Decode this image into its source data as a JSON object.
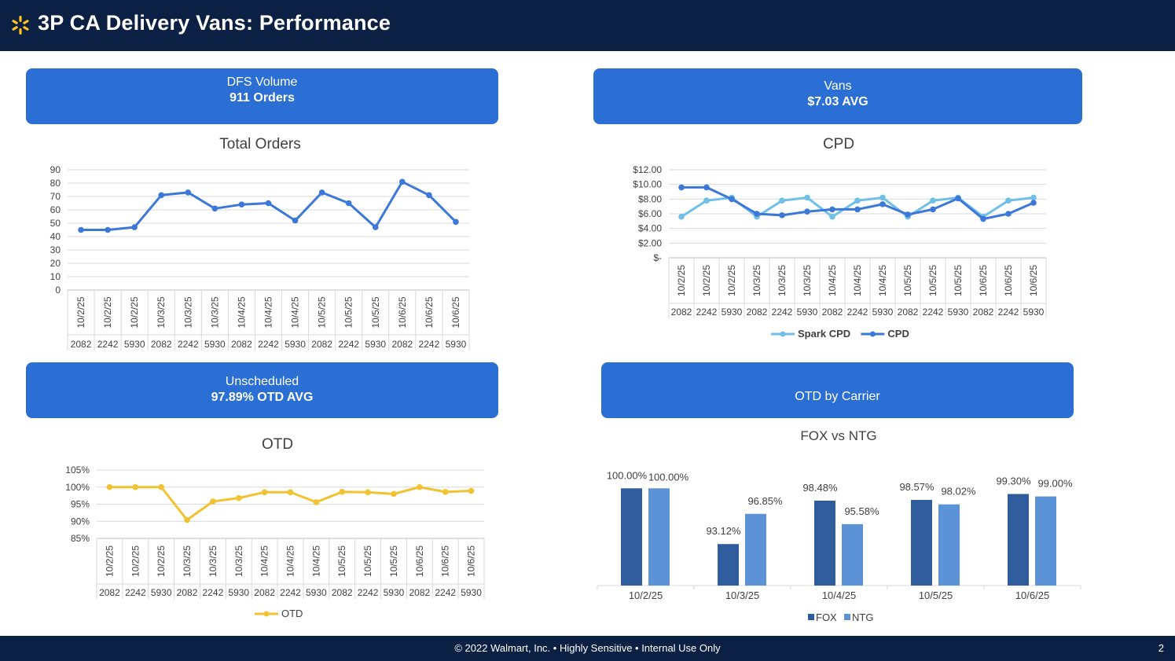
{
  "header": {
    "title": "3P CA Delivery Vans: Performance",
    "logo_icon": "walmart-spark-icon",
    "accent": "#ffc220",
    "background": "#0b2042"
  },
  "banners": {
    "dfs": {
      "line1": "DFS Volume",
      "line2": "911 Orders"
    },
    "vans": {
      "line1": "Vans",
      "line2": "$7.03 AVG"
    },
    "unscheduled": {
      "line1": "Unscheduled",
      "line2": "97.89% OTD AVG"
    },
    "carrier": {
      "line1": "OTD by Carrier",
      "line2": ""
    },
    "color": "#2b6fd4"
  },
  "chart_data": [
    {
      "id": "total_orders",
      "type": "line",
      "title": "Total Orders",
      "categories_date": [
        "10/2/25",
        "10/2/25",
        "10/2/25",
        "10/3/25",
        "10/3/25",
        "10/3/25",
        "10/4/25",
        "10/4/25",
        "10/4/25",
        "10/5/25",
        "10/5/25",
        "10/5/25",
        "10/6/25",
        "10/6/25",
        "10/6/25"
      ],
      "categories_store": [
        "2082",
        "2242",
        "5930",
        "2082",
        "2242",
        "5930",
        "2082",
        "2242",
        "5930",
        "2082",
        "2242",
        "5930",
        "2082",
        "2242",
        "5930"
      ],
      "series": [
        {
          "values": [
            45,
            45,
            47,
            71,
            73,
            61,
            64,
            65,
            52,
            73,
            65,
            47,
            81,
            71,
            51
          ],
          "color": "#3c78d8"
        }
      ],
      "ylim": [
        0,
        90
      ],
      "yticks": [
        "0",
        "10",
        "20",
        "30",
        "40",
        "50",
        "60",
        "70",
        "80",
        "90"
      ],
      "grid": true
    },
    {
      "id": "cpd",
      "type": "line",
      "title": "CPD",
      "categories_date": [
        "10/2/25",
        "10/2/25",
        "10/2/25",
        "10/3/25",
        "10/3/25",
        "10/3/25",
        "10/4/25",
        "10/4/25",
        "10/4/25",
        "10/5/25",
        "10/5/25",
        "10/5/25",
        "10/6/25",
        "10/6/25",
        "10/6/25"
      ],
      "categories_store": [
        "2082",
        "2242",
        "5930",
        "2082",
        "2242",
        "5930",
        "2082",
        "2242",
        "5930",
        "2082",
        "2242",
        "5930",
        "2082",
        "2242",
        "5930"
      ],
      "series": [
        {
          "name": "Spark CPD",
          "values": [
            5.6,
            7.8,
            8.2,
            5.6,
            7.8,
            8.2,
            5.6,
            7.8,
            8.2,
            5.6,
            7.8,
            8.2,
            5.6,
            7.8,
            8.2
          ],
          "color": "#6fbfe8"
        },
        {
          "name": "CPD",
          "values": [
            9.6,
            9.6,
            8.0,
            6.0,
            5.8,
            6.3,
            6.6,
            6.6,
            7.3,
            5.9,
            6.6,
            8.1,
            5.3,
            6.0,
            7.5
          ],
          "color": "#3c78d8"
        }
      ],
      "ylim": [
        0,
        12
      ],
      "yticks": [
        "$-",
        "$2.00",
        "$4.00",
        "$6.00",
        "$8.00",
        "$10.00",
        "$12.00"
      ],
      "legend": "bottom",
      "grid": true
    },
    {
      "id": "otd",
      "type": "line",
      "title": "OTD",
      "categories_date": [
        "10/2/25",
        "10/2/25",
        "10/2/25",
        "10/3/25",
        "10/3/25",
        "10/3/25",
        "10/4/25",
        "10/4/25",
        "10/4/25",
        "10/5/25",
        "10/5/25",
        "10/5/25",
        "10/6/25",
        "10/6/25",
        "10/6/25"
      ],
      "categories_store": [
        "2082",
        "2242",
        "5930",
        "2082",
        "2242",
        "5930",
        "2082",
        "2242",
        "5930",
        "2082",
        "2242",
        "5930",
        "2082",
        "2242",
        "5930"
      ],
      "series": [
        {
          "name": "OTD",
          "values": [
            100,
            100,
            100,
            90.4,
            95.8,
            96.8,
            98.5,
            98.5,
            95.6,
            98.6,
            98.5,
            98.0,
            100,
            98.6,
            98.9
          ],
          "color": "#f1c232"
        }
      ],
      "ylim": [
        85,
        105
      ],
      "yticks": [
        "85%",
        "90%",
        "95%",
        "100%",
        "105%"
      ],
      "legend": "bottom",
      "grid": true
    },
    {
      "id": "fox_ntg",
      "type": "bar",
      "title": "FOX vs NTG",
      "categories": [
        "10/2/25",
        "10/3/25",
        "10/4/25",
        "10/5/25",
        "10/6/25"
      ],
      "series": [
        {
          "name": "FOX",
          "values": [
            100.0,
            93.12,
            98.48,
            98.57,
            99.3
          ],
          "labels": [
            "100.00%",
            "93.12%",
            "98.48%",
            "98.57%",
            "99.30%"
          ],
          "color": "#2e5c9c"
        },
        {
          "name": "NTG",
          "values": [
            100.0,
            96.85,
            95.58,
            98.02,
            99.0
          ],
          "labels": [
            "100.00%",
            "96.85%",
            "95.58%",
            "98.02%",
            "99.00%"
          ],
          "color": "#5b93d6"
        }
      ],
      "ylim": [
        88,
        101
      ],
      "legend": "bottom",
      "grid": false
    }
  ],
  "footer": {
    "text": "© 2022 Walmart, Inc. • Highly Sensitive • Internal Use Only",
    "page": "2"
  }
}
